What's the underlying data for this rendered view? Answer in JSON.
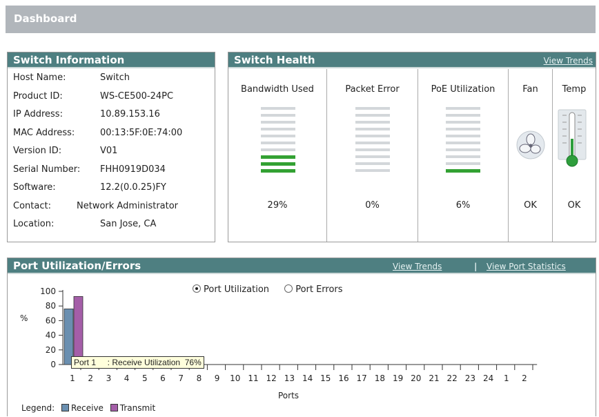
{
  "header": {
    "title": "Dashboard"
  },
  "switch_info": {
    "title": "Switch Information",
    "rows": [
      {
        "label": "Host Name:",
        "value": "Switch"
      },
      {
        "label": "Product ID:",
        "value": "WS-CE500-24PC"
      },
      {
        "label": "IP Address:",
        "value": "10.89.153.16"
      },
      {
        "label": "MAC Address:",
        "value": "00:13:5F:0E:74:00"
      },
      {
        "label": "Version ID:",
        "value": "V01"
      },
      {
        "label": "Serial Number:",
        "value": "FHH0919D034"
      },
      {
        "label": "Software:",
        "value": "12.2(0.0.25)FY"
      },
      {
        "label": "Contact:",
        "value": "Network Administrator"
      },
      {
        "label": "Location:",
        "value": "San Jose, CA"
      }
    ]
  },
  "switch_health": {
    "title": "Switch Health",
    "view_trends": "View Trends",
    "bandwidth": {
      "label": "Bandwidth Used",
      "value": "29%",
      "lit_bars": 3
    },
    "packet_error": {
      "label": "Packet Error",
      "value": "0%",
      "lit_bars": 0
    },
    "poe": {
      "label": "PoE Utilization",
      "value": "6%",
      "lit_bars": 1
    },
    "fan": {
      "label": "Fan",
      "value": "OK",
      "icon": "fan-icon"
    },
    "temp": {
      "label": "Temp",
      "value": "OK",
      "icon": "thermometer-icon"
    },
    "colors": {
      "on": "#33a133",
      "off": "#d3d7da"
    }
  },
  "port_panel": {
    "title": "Port Utilization/Errors",
    "view_trends": "View Trends",
    "separator": "|",
    "view_port_stats": "View Port Statistics",
    "radio_utilization": "Port Utilization",
    "radio_errors": "Port Errors",
    "selected": "utilization",
    "tooltip": "Port 1     : Receive Utilization  76%",
    "legend_label": "Legend:",
    "legend_receive": "Receive",
    "legend_transmit": "Transmit"
  },
  "chart_data": {
    "type": "bar",
    "ylabel": "%",
    "xlabel": "Ports",
    "ylim": [
      0,
      100
    ],
    "yticks": [
      "100",
      "80",
      "60",
      "40",
      "20",
      "0"
    ],
    "categories": [
      "1",
      "2",
      "3",
      "4",
      "5",
      "6",
      "7",
      "8",
      "9",
      "10",
      "11",
      "12",
      "13",
      "14",
      "15",
      "16",
      "17",
      "18",
      "19",
      "20",
      "21",
      "22",
      "23",
      "24",
      "1",
      "2"
    ],
    "series": [
      {
        "name": "Receive",
        "color": "#6a8fb0",
        "values": [
          76,
          0,
          0,
          0,
          0,
          0,
          0,
          0,
          0,
          0,
          0,
          0,
          0,
          0,
          0,
          0,
          0,
          0,
          0,
          0,
          0,
          0,
          0,
          0,
          0,
          0
        ]
      },
      {
        "name": "Transmit",
        "color": "#a45ea8",
        "values": [
          93,
          0,
          0,
          0,
          0,
          0,
          0,
          0,
          0,
          0,
          0,
          0,
          0,
          0,
          0,
          0,
          0,
          0,
          0,
          0,
          0,
          0,
          0,
          0,
          0,
          0
        ]
      }
    ]
  }
}
